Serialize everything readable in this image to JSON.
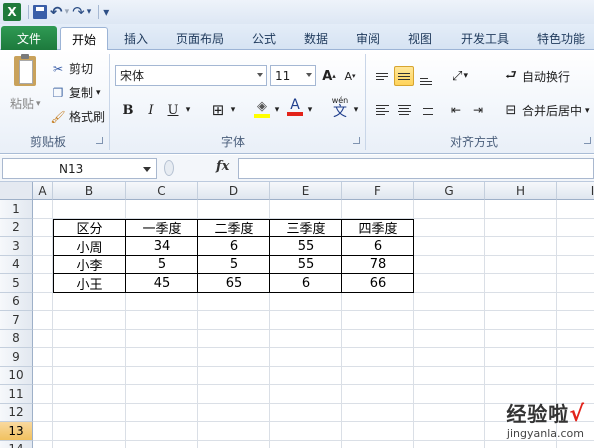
{
  "qat": {
    "logo": "X",
    "undo": "↶",
    "redo": "↷",
    "more": "▾"
  },
  "tabs": [
    "文件",
    "开始",
    "插入",
    "页面布局",
    "公式",
    "数据",
    "审阅",
    "视图",
    "开发工具",
    "特色功能"
  ],
  "clipboard": {
    "paste": "粘贴",
    "cut": "剪切",
    "copy": "复制",
    "format_painter": "格式刷",
    "group_label": "剪贴板"
  },
  "font": {
    "name": "宋体",
    "size": "11",
    "group_label": "字体",
    "grow": "A",
    "shrink": "A",
    "bold": "B",
    "italic": "I",
    "underline": "U",
    "font_color_letter": "A",
    "wen": "wén",
    "wen_char": "文"
  },
  "alignment": {
    "wrap_text": "自动换行",
    "merge_center": "合并后居中",
    "group_label": "对齐方式"
  },
  "formula_bar": {
    "name_box": "N13",
    "fx": "fx",
    "formula": ""
  },
  "grid": {
    "columns": [
      "A",
      "B",
      "C",
      "D",
      "E",
      "F",
      "G",
      "H",
      "I"
    ],
    "rows": [
      "1",
      "2",
      "3",
      "4",
      "5",
      "6",
      "7",
      "8",
      "9",
      "10",
      "11",
      "12",
      "13",
      "14"
    ],
    "selected_row": "13"
  },
  "table": {
    "headers": [
      "区分",
      "一季度",
      "二季度",
      "三季度",
      "四季度"
    ],
    "rows": [
      [
        "小周",
        "34",
        "6",
        "55",
        "6"
      ],
      [
        "小李",
        "5",
        "5",
        "55",
        "78"
      ],
      [
        "小王",
        "45",
        "65",
        "6",
        "66"
      ]
    ]
  },
  "watermark": {
    "text": "经验啦",
    "check": "√",
    "url": "jingyanla.com"
  },
  "colors": {
    "file_tab": "#1d7a3d",
    "selected_row": "#f1c15f",
    "underline_red": "#e2231a",
    "highlight_yellow": "#ffff00"
  }
}
